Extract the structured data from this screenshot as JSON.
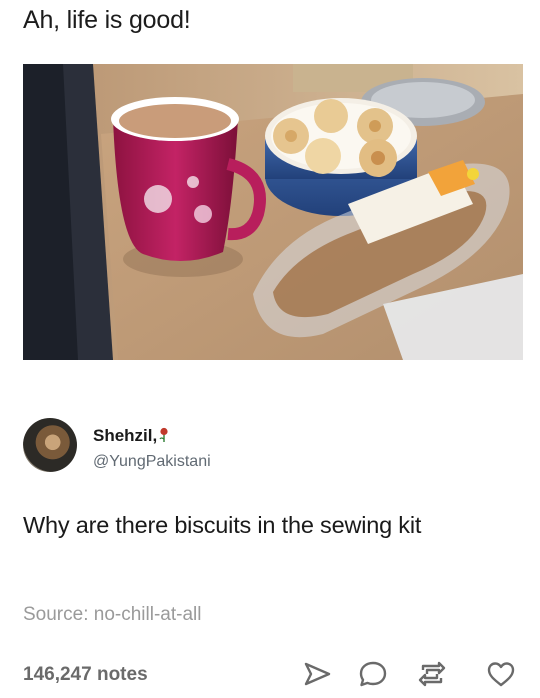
{
  "post": {
    "title": "Ah, life is good!"
  },
  "tweet": {
    "display_name": "Shehzil,",
    "handle": "@YungPakistani",
    "text": "Why are there biscuits in the sewing kit"
  },
  "source": {
    "label": "Source:",
    "link": "no-chill-at-all"
  },
  "footer": {
    "notes": "146,247 notes",
    "actions": [
      {
        "icon": "share-icon"
      },
      {
        "icon": "comment-icon"
      },
      {
        "icon": "reblog-icon"
      },
      {
        "icon": "heart-icon"
      }
    ]
  },
  "colors": {
    "text_primary": "#1a1a1a",
    "text_secondary": "#616a73",
    "text_muted": "#9a9a9a",
    "icon": "#6a6a6a"
  }
}
